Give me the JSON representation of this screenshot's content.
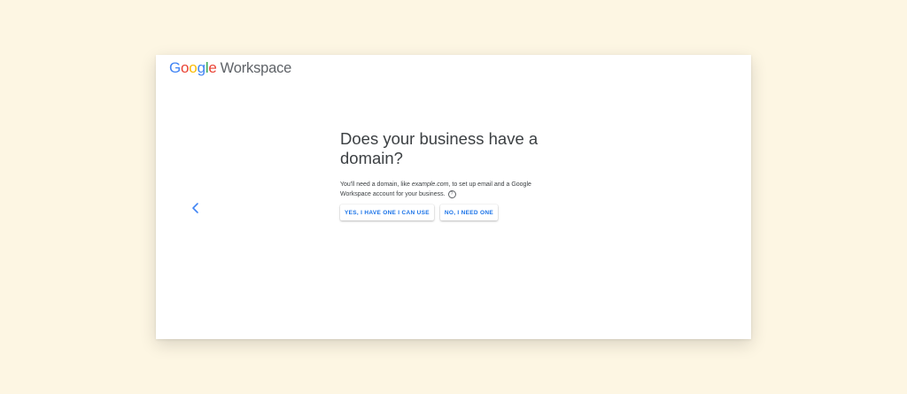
{
  "logo": {
    "letters": [
      "G",
      "o",
      "o",
      "g",
      "l",
      "e"
    ],
    "product": "Workspace",
    "colors": [
      "#4285f4",
      "#ea4335",
      "#fbbc05",
      "#4285f4",
      "#34a853",
      "#ea4335"
    ]
  },
  "nav": {
    "back_icon": "chevron-left-icon"
  },
  "main": {
    "title": "Does your business have a domain?",
    "desc_before": "You'll need a domain, like ",
    "desc_example": "example.com",
    "desc_after": ", to set up email and a Google Workspace account for your business.",
    "help_glyph": "?",
    "buttons": {
      "yes_label": "YES, I HAVE ONE I CAN USE",
      "no_label": "NO, I NEED ONE"
    }
  },
  "colors": {
    "accent": "#1a73e8",
    "background": "#fdf6e3"
  }
}
